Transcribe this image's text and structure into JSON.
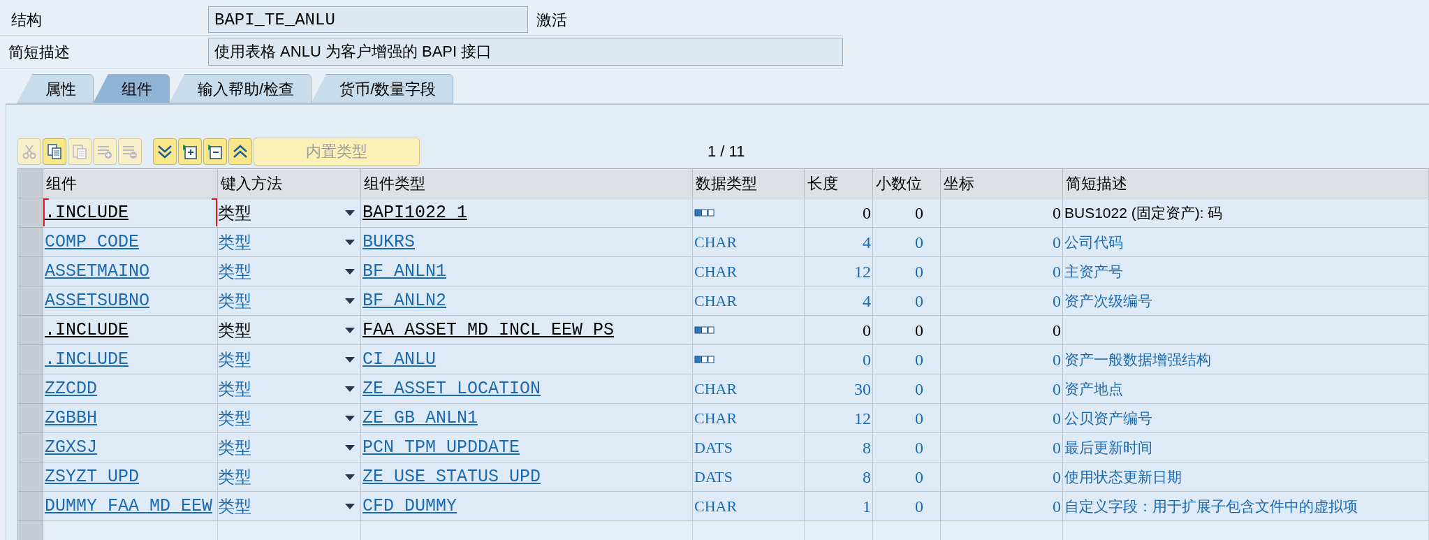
{
  "header": {
    "structure_label": "结构",
    "structure_value": "BAPI_TE_ANLU",
    "status": "激活",
    "description_label": "简短描述",
    "description_value": "使用表格 ANLU 为客户增强的 BAPI 接口"
  },
  "tabs": [
    {
      "label": "属性",
      "selected": false
    },
    {
      "label": "组件",
      "selected": true
    },
    {
      "label": "输入帮助/检查",
      "selected": false
    },
    {
      "label": "货币/数量字段",
      "selected": false
    }
  ],
  "toolbar": [
    {
      "kind": "cut",
      "disabled": true
    },
    {
      "kind": "copy",
      "disabled": false
    },
    {
      "kind": "paste",
      "disabled": true
    },
    {
      "kind": "insert-row",
      "disabled": true
    },
    {
      "kind": "delete-row",
      "disabled": true
    }
  ],
  "toolbar_nav": [
    {
      "kind": "down"
    },
    {
      "kind": "expand"
    },
    {
      "kind": "collapse"
    },
    {
      "kind": "up"
    }
  ],
  "builtin_button": {
    "label": "内置类型",
    "disabled": true
  },
  "pager": "1 / 11",
  "table": {
    "columns": [
      "组件",
      "键入方法",
      "组件类型",
      "数据类型",
      "长度",
      "小数位",
      "坐标",
      "简短描述"
    ],
    "rows": [
      {
        "component": ".INCLUDE",
        "entry": "类型",
        "type": "BAPI1022_1",
        "kind": "structure",
        "length": "0",
        "decimals": "0",
        "coordinate": "0",
        "description": "BUS1022 (固定资产): 码",
        "editable": true,
        "focused": true
      },
      {
        "component": "COMP_CODE",
        "entry": "类型",
        "type": "BUKRS",
        "kind": "element",
        "data_type": "CHAR",
        "length": "4",
        "decimals": "0",
        "coordinate": "0",
        "description": "公司代码",
        "editable": false,
        "focused": false
      },
      {
        "component": "ASSETMAINO",
        "entry": "类型",
        "type": "BF_ANLN1",
        "kind": "element",
        "data_type": "CHAR",
        "length": "12",
        "decimals": "0",
        "coordinate": "0",
        "description": "主资产号",
        "editable": false,
        "focused": false
      },
      {
        "component": "ASSETSUBNO",
        "entry": "类型",
        "type": "BF_ANLN2",
        "kind": "element",
        "data_type": "CHAR",
        "length": "4",
        "decimals": "0",
        "coordinate": "0",
        "description": "资产次级编号",
        "editable": false,
        "focused": false
      },
      {
        "component": ".INCLUDE",
        "entry": "类型",
        "type": "FAA_ASSET_MD_INCL_EEW_PS",
        "kind": "structure",
        "length": "0",
        "decimals": "0",
        "coordinate": "0",
        "editable": true,
        "focused": false
      },
      {
        "component": ".INCLUDE",
        "entry": "类型",
        "type": "CI_ANLU",
        "kind": "structure",
        "length": "0",
        "decimals": "0",
        "coordinate": "0",
        "description": "资产一般数据增强结构",
        "editable": false,
        "focused": false
      },
      {
        "component": "ZZCDD",
        "entry": "类型",
        "type": "ZE_ASSET_LOCATION",
        "kind": "element",
        "data_type": "CHAR",
        "length": "30",
        "decimals": "0",
        "coordinate": "0",
        "description": "资产地点",
        "editable": false,
        "focused": false
      },
      {
        "component": "ZGBBH",
        "entry": "类型",
        "type": "ZE_GB_ANLN1",
        "kind": "element",
        "data_type": "CHAR",
        "length": "12",
        "decimals": "0",
        "coordinate": "0",
        "description": "公贝资产编号",
        "editable": false,
        "focused": false
      },
      {
        "component": "ZGXSJ",
        "entry": "类型",
        "type": "PCN_TPM_UPDDATE",
        "kind": "element",
        "data_type": "DATS",
        "length": "8",
        "decimals": "0",
        "coordinate": "0",
        "description": "最后更新时间",
        "editable": false,
        "focused": false
      },
      {
        "component": "ZSYZT_UPD",
        "entry": "类型",
        "type": "ZE_USE_STATUS_UPD",
        "kind": "element",
        "data_type": "DATS",
        "length": "8",
        "decimals": "0",
        "coordinate": "0",
        "description": "使用状态更新日期",
        "editable": false,
        "focused": false
      },
      {
        "component": "DUMMY_FAA_MD_EEW",
        "entry": "类型",
        "type": "CFD_DUMMY",
        "kind": "element",
        "data_type": "CHAR",
        "length": "1",
        "decimals": "0",
        "coordinate": "0",
        "description": "自定义字段：用于扩展子包含文件中的虚拟项",
        "editable": false,
        "focused": false
      }
    ]
  }
}
